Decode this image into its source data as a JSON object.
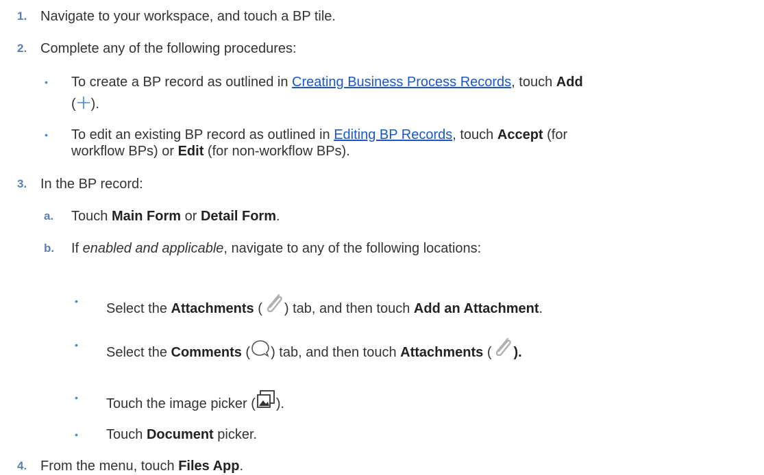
{
  "steps": [
    {
      "num": "1.",
      "pre": "Navigate to your workspace, and touch a BP tile."
    },
    {
      "num": "2.",
      "pre": "Complete any of the following procedures:",
      "bullets": [
        {
          "pre": "To create a BP record as outlined in ",
          "link": "Creating Business Process Records",
          "mid": ", touch ",
          "bold": "Add",
          "line2_open": "(",
          "line2_close": ")."
        },
        {
          "pre": "To edit an existing BP record as outlined in ",
          "link": "Editing BP Records",
          "mid": ", touch ",
          "bold1": "Accept",
          "post1": " (for",
          "line2_pre": "workflow BPs) or ",
          "bold2": "Edit",
          "line2_post": " (for non-workflow BPs)."
        }
      ]
    },
    {
      "num": "3.",
      "pre": "In the BP record:",
      "substeps": [
        {
          "letter": "a.",
          "pre": "Touch ",
          "bold1": "Main Form",
          "mid": " or ",
          "bold2": "Detail Form",
          "post": "."
        },
        {
          "letter": "b.",
          "pre": "If ",
          "italic": "enabled and applicable",
          "post": ", navigate to any of the following locations:",
          "bullets": [
            {
              "pre": "Select the ",
              "bold1": "Attachments",
              "open": " (",
              "close": ") tab, and then touch ",
              "bold2": "Add an Attachment",
              "post": "."
            },
            {
              "pre": "Select the ",
              "bold1": "Comments",
              "open": " (",
              "close": ") tab, and then touch ",
              "bold2": "Attachments",
              "open2": " (",
              "close2": ")."
            },
            {
              "pre": "Touch the image picker (",
              "post": ")."
            },
            {
              "pre": "Touch ",
              "bold": "Document",
              "post": " picker."
            }
          ]
        }
      ]
    },
    {
      "num": "4.",
      "pre": "From the menu, touch ",
      "bold": "Files App",
      "post": "."
    }
  ],
  "icons": {
    "add": "plus-icon",
    "attachment": "paperclip-icon",
    "comments": "speech-bubble-icon",
    "image_picker": "image-picker-icon"
  },
  "colors": {
    "number": "#5a7fb0",
    "bullet": "#4a86c8",
    "link": "#1a57c9",
    "plus": "#3a8ad8"
  }
}
